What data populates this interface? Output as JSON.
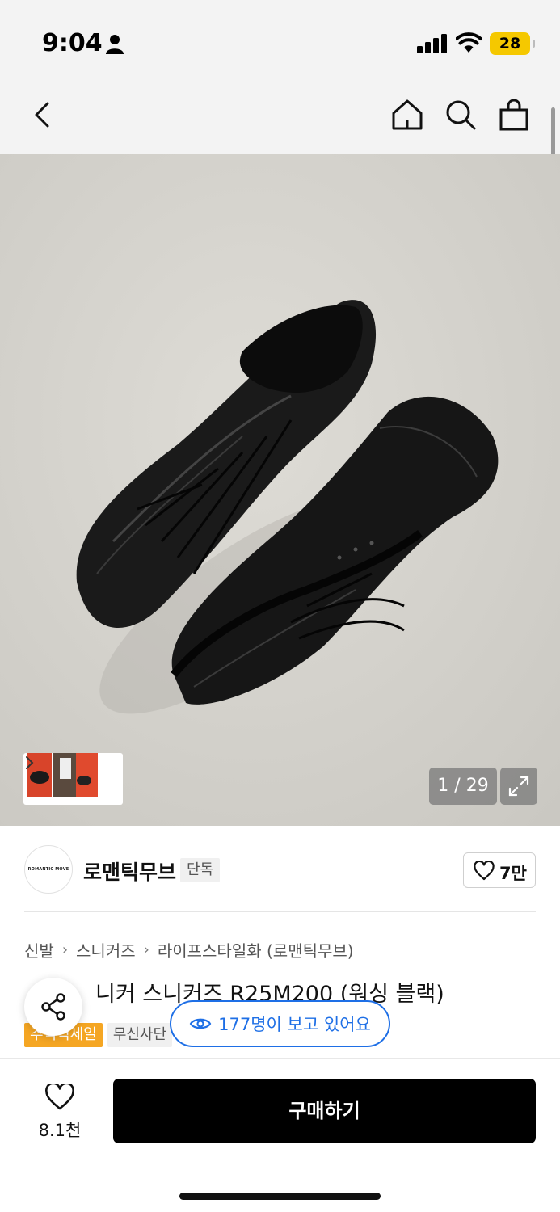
{
  "status_bar": {
    "time": "9:04",
    "battery": "28",
    "icons": [
      "person-icon",
      "signal-icon",
      "wifi-icon",
      "battery-icon"
    ]
  },
  "nav": {
    "icons": [
      "back-icon",
      "home-icon",
      "search-icon",
      "shopping-bag-icon"
    ]
  },
  "gallery": {
    "counter": "1 / 29",
    "current": 1,
    "total": 29,
    "icons": [
      "chevron-right-icon",
      "expand-icon"
    ]
  },
  "brand": {
    "logo_text": "ROMANTIC MOVE",
    "name": "로맨틱무브",
    "badge": "단독",
    "likes": "7만"
  },
  "breadcrumb": [
    "신발",
    "스니커즈",
    "라이프스타일화 (로맨틱무브)"
  ],
  "product": {
    "title": "니커 스니커즈 R25M200 (워싱 블랙)",
    "tags": [
      "추석빅세일",
      "무신사단"
    ]
  },
  "viewers": {
    "text": "177명이 보고 있어요"
  },
  "bottom_bar": {
    "wish_count": "8.1천",
    "buy_label": "구매하기"
  },
  "colors": {
    "accent_blue": "#1e6fe6",
    "sale_orange": "#f5a623",
    "buy_black": "#000000",
    "battery_yellow": "#f5c800"
  }
}
